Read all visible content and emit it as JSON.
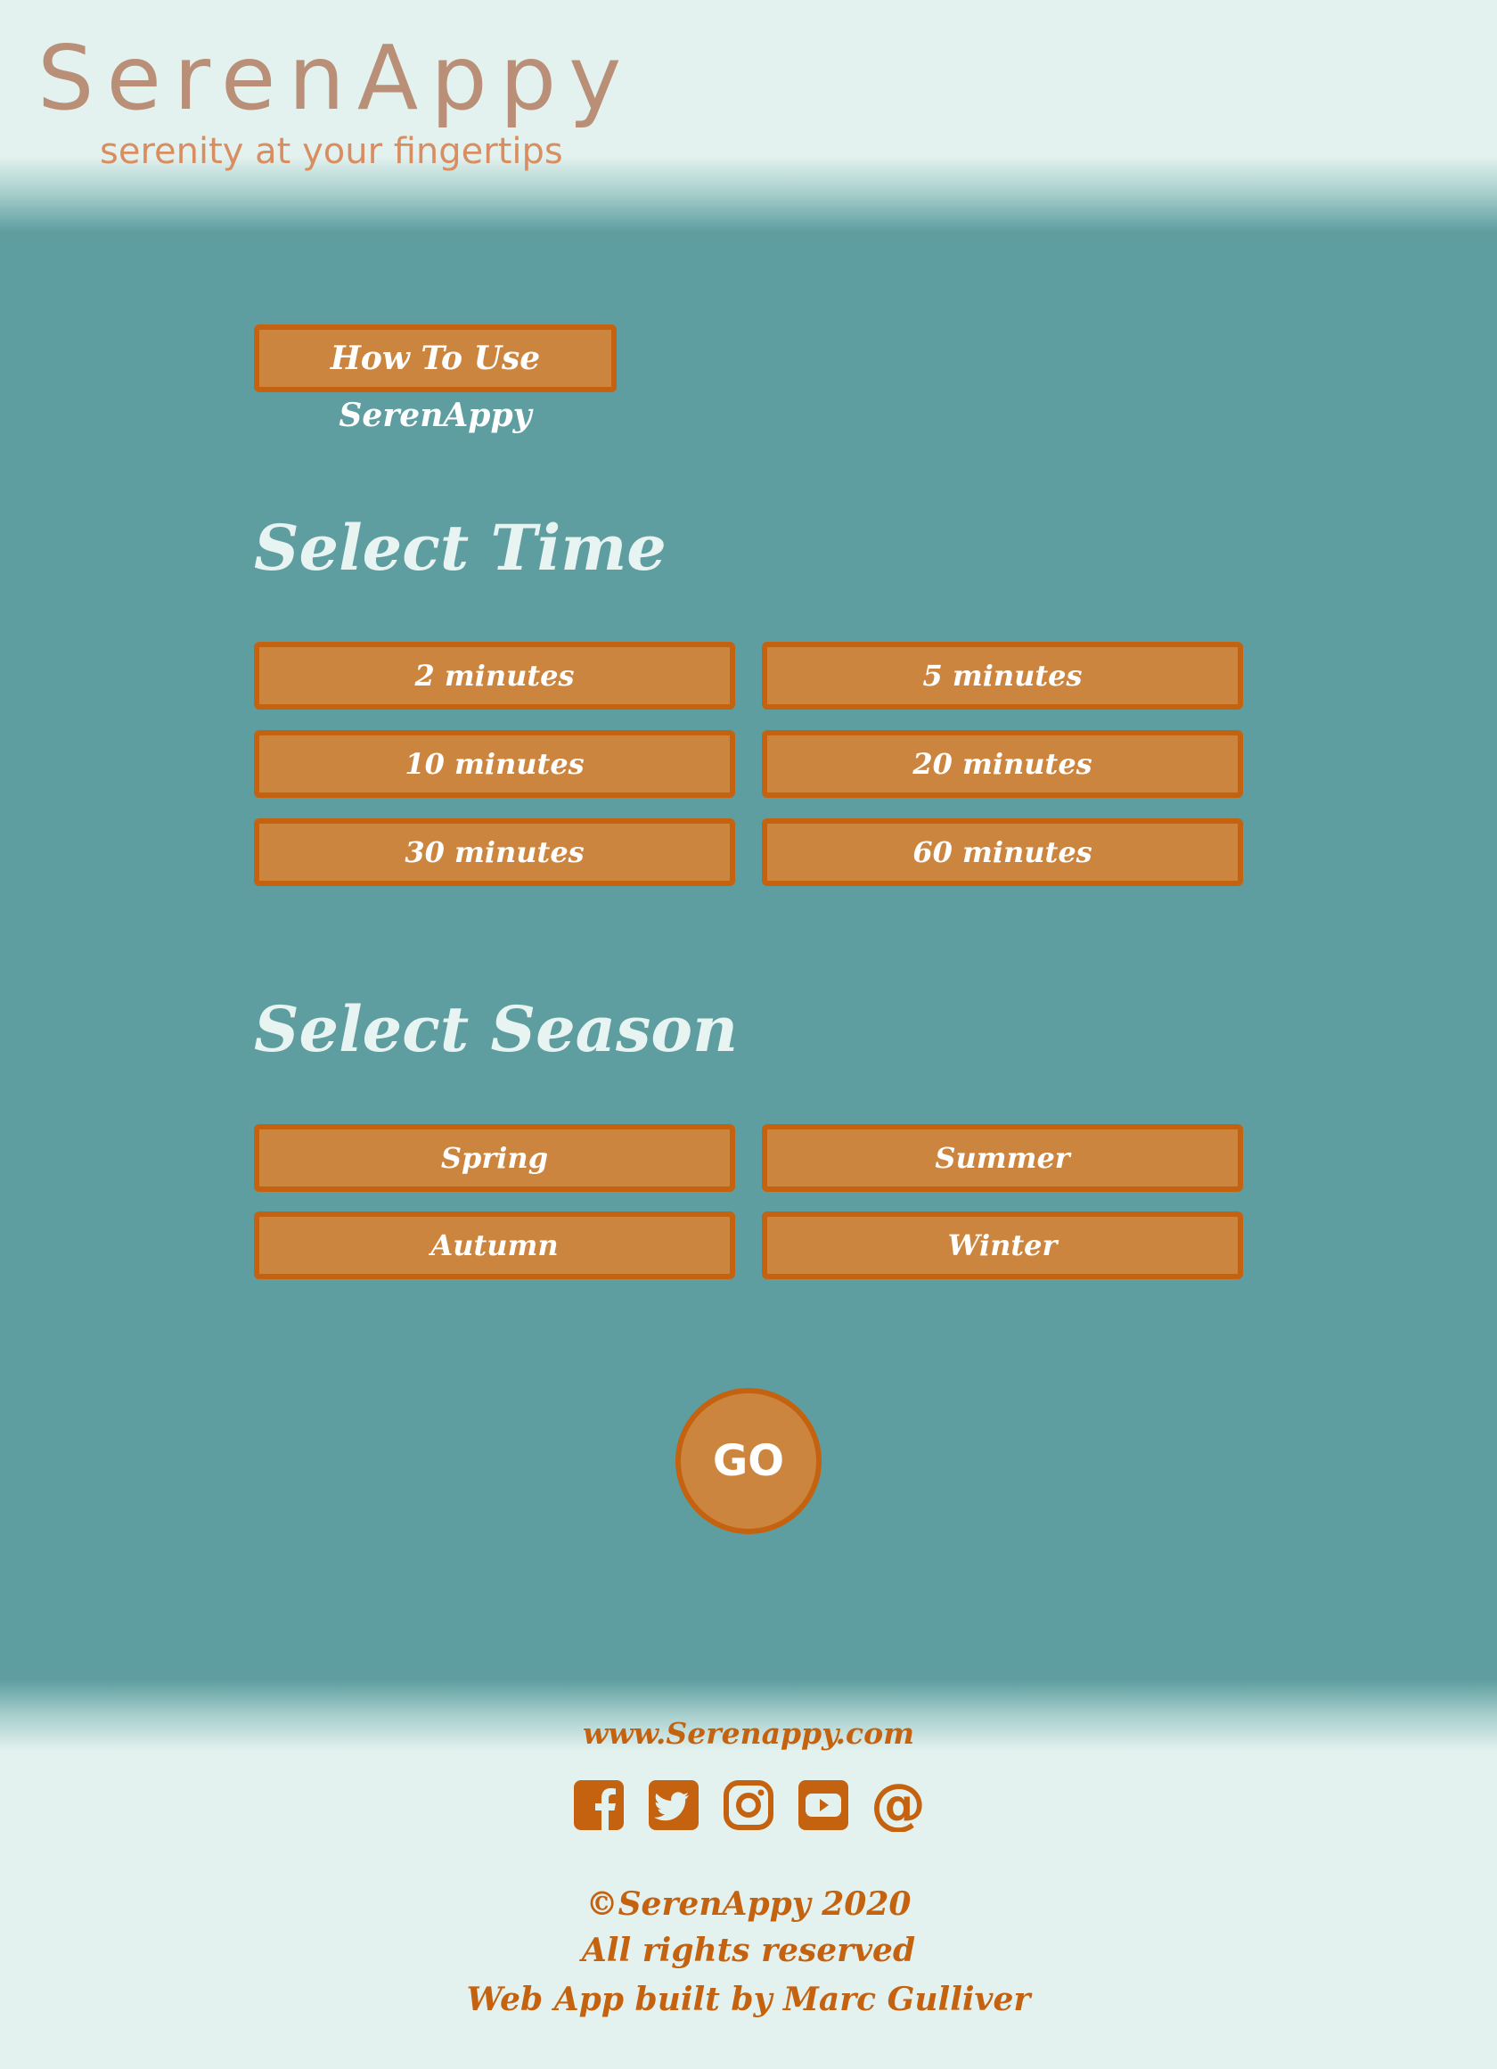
{
  "header": {
    "logo": "SerenAppy",
    "tagline": "serenity at your fingertips"
  },
  "how_to_button": "How To Use SerenAppy",
  "time_section": {
    "title": "Select Time",
    "options": [
      "2 minutes",
      "5 minutes",
      "10 minutes",
      "20 minutes",
      "30 minutes",
      "60 minutes"
    ]
  },
  "season_section": {
    "title": "Select Season",
    "options": [
      "Spring",
      "Summer",
      "Autumn",
      "Winter"
    ]
  },
  "go_button": "GO",
  "footer": {
    "url": "www.Serenappy.com",
    "social_icons": [
      "facebook-icon",
      "twitter-icon",
      "instagram-icon",
      "youtube-icon",
      "at-sign-icon"
    ],
    "copyright": "©SerenAppy 2020",
    "rights": "All rights reserved",
    "credit": "Web App built by Marc Gulliver"
  },
  "colors": {
    "background": "#e4f2ef",
    "teal": "#5f9ea0",
    "button_fill": "#cc853f",
    "button_border": "#c4620f",
    "logo": "#b98f77",
    "tagline": "#d98e62",
    "footer_text": "#c4620f"
  }
}
